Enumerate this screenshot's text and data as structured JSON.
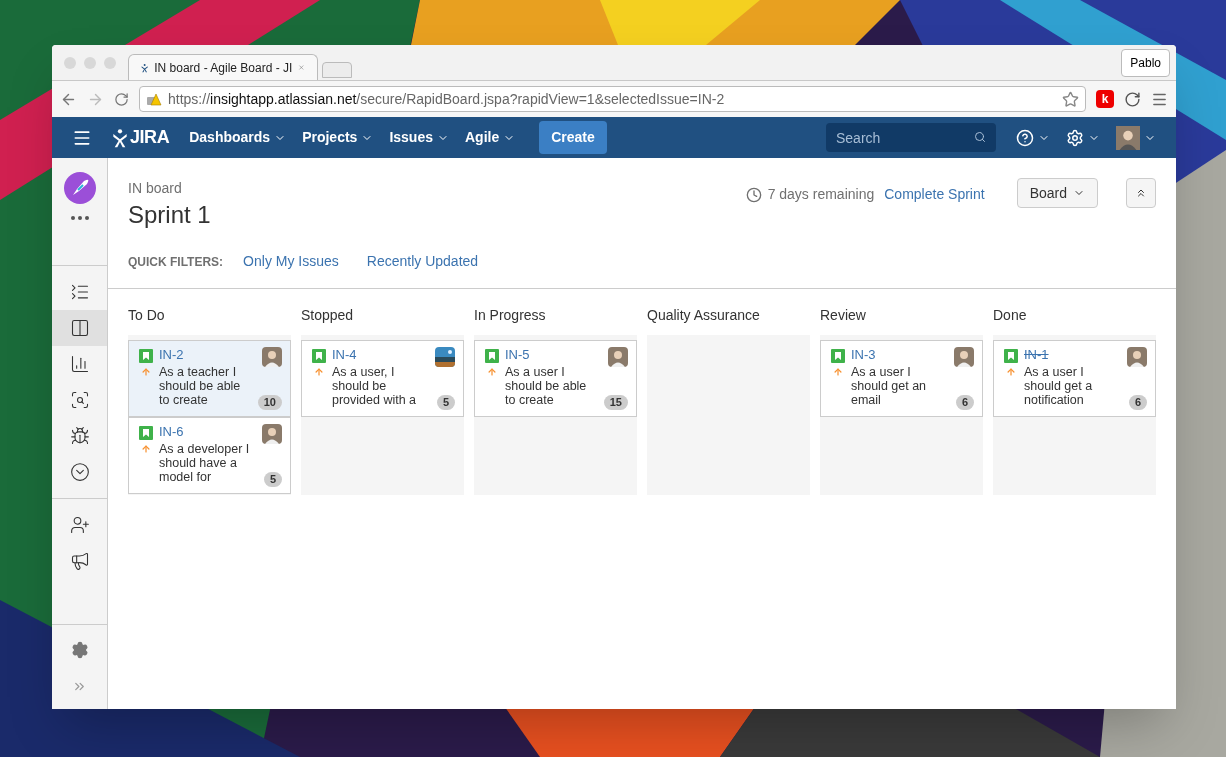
{
  "browser": {
    "tab_title": "IN board - Agile Board - JI",
    "profile": "Pablo",
    "url_scheme": "https://",
    "url_host": "insightapp.atlassian.net",
    "url_path": "/secure/RapidBoard.jspa?rapidView=1&selectedIssue=IN-2",
    "extension_letter": "k"
  },
  "nav": {
    "logo": "JIRA",
    "menus": [
      "Dashboards",
      "Projects",
      "Issues",
      "Agile"
    ],
    "create": "Create",
    "search": {
      "placeholder": "Search"
    }
  },
  "sidebar": {
    "items": [
      {
        "selected": false
      },
      {
        "selected": true
      },
      {
        "selected": false
      },
      {
        "selected": false
      },
      {
        "selected": false
      },
      {
        "selected": false
      }
    ]
  },
  "header": {
    "breadcrumb": "IN board",
    "title": "Sprint 1",
    "remaining": "7 days remaining",
    "complete": "Complete Sprint",
    "board_button": "Board"
  },
  "quick_filters": {
    "label": "QUICK FILTERS:",
    "filters": [
      "Only My Issues",
      "Recently Updated"
    ]
  },
  "columns": [
    {
      "title": "To Do",
      "cards": [
        {
          "key": "IN-2",
          "summary": "As a teacher I should be able to create",
          "estimate": "10",
          "selected": true,
          "done": false
        },
        {
          "key": "IN-6",
          "summary": "As a developer I should have a model for",
          "estimate": "5",
          "selected": false,
          "done": false
        }
      ]
    },
    {
      "title": "Stopped",
      "cards": [
        {
          "key": "IN-4",
          "summary": "As a user, I should be provided with a",
          "estimate": "5",
          "selected": false,
          "done": false,
          "kind": "picture"
        }
      ]
    },
    {
      "title": "In Progress",
      "cards": [
        {
          "key": "IN-5",
          "summary": "As a user I should be able to create",
          "estimate": "15",
          "selected": false,
          "done": false
        }
      ]
    },
    {
      "title": "Quality Assurance"
    },
    {
      "title": "Review",
      "cards": [
        {
          "key": "IN-3",
          "summary": "As a user I should get an email",
          "estimate": "6",
          "selected": false,
          "done": false
        }
      ]
    },
    {
      "title": "Done",
      "cards": [
        {
          "key": "IN-1",
          "summary": "As a user I should get a notification",
          "estimate": "6",
          "selected": false,
          "done": true
        }
      ]
    }
  ]
}
